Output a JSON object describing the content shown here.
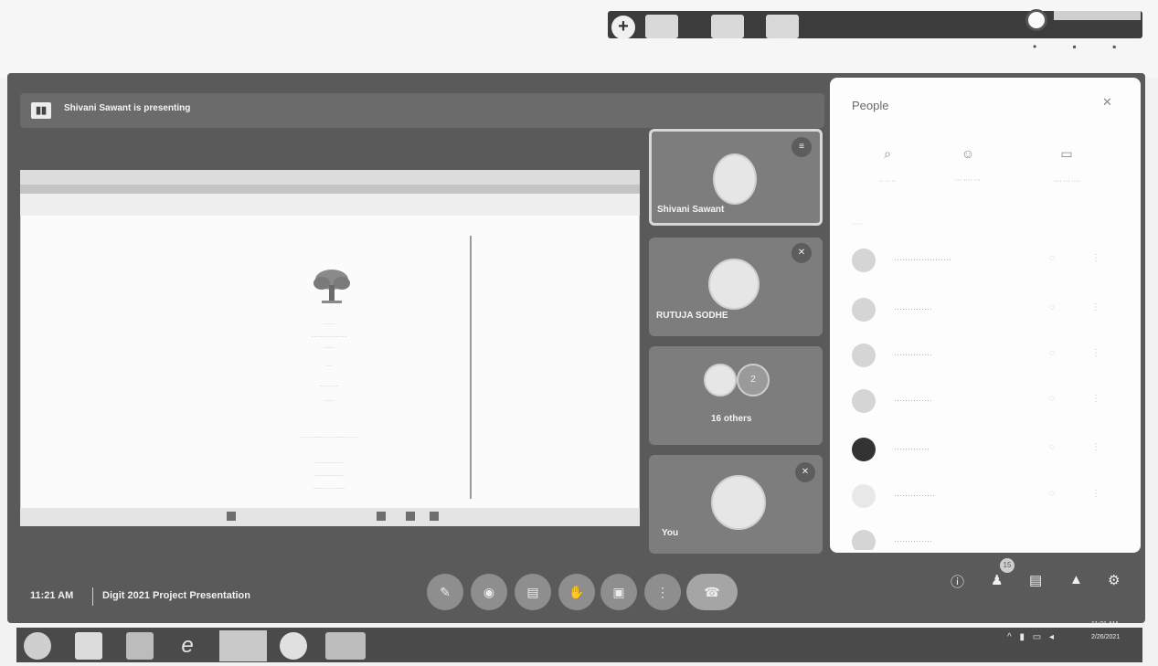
{
  "presenting_banner": "Shivani Sawant is presenting",
  "tiles": [
    {
      "name": "Shivani Sawant"
    },
    {
      "name": "RUTUJA SODHE"
    },
    {
      "name": "16 others",
      "count": "2"
    },
    {
      "name": "You"
    }
  ],
  "people_panel": {
    "title": "People"
  },
  "meeting": {
    "time": "11:21 AM",
    "title": "Digit 2021 Project Presentation",
    "participants_badge": "15"
  },
  "taskbar": {
    "clock_time": "11:21 AM",
    "clock_date": "2/26/2021"
  }
}
